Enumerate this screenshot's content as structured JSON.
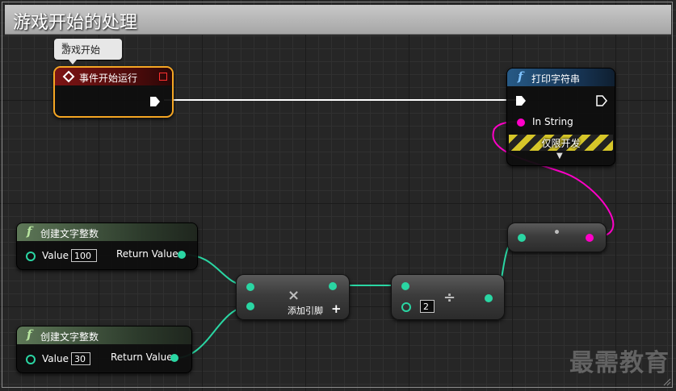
{
  "comment": {
    "title": "游戏开始的处理"
  },
  "bubble": {
    "text": "游戏开始"
  },
  "event_node": {
    "title": "事件开始运行"
  },
  "print_node": {
    "title": "打印字符串",
    "in_string_label": "In String",
    "dev_only_label": "仅限开发"
  },
  "int_node_1": {
    "title": "创建文字整数",
    "value_label": "Value",
    "value": "100",
    "return_label": "Return Value"
  },
  "int_node_2": {
    "title": "创建文字整数",
    "value_label": "Value",
    "value": "30",
    "return_label": "Return Value"
  },
  "add_node": {
    "symbol": "×",
    "add_pin_label": "添加引脚",
    "plus": "+"
  },
  "divide_node": {
    "symbol": "÷",
    "divisor": "2"
  },
  "convert_node": {
    "symbol": "•"
  },
  "watermark": {
    "text": "最需教育"
  },
  "colors": {
    "float_pin": "#2ad6a3",
    "string_pin": "#ff00c8",
    "exec_wire": "#ffffff",
    "selection": "#f5a623"
  }
}
